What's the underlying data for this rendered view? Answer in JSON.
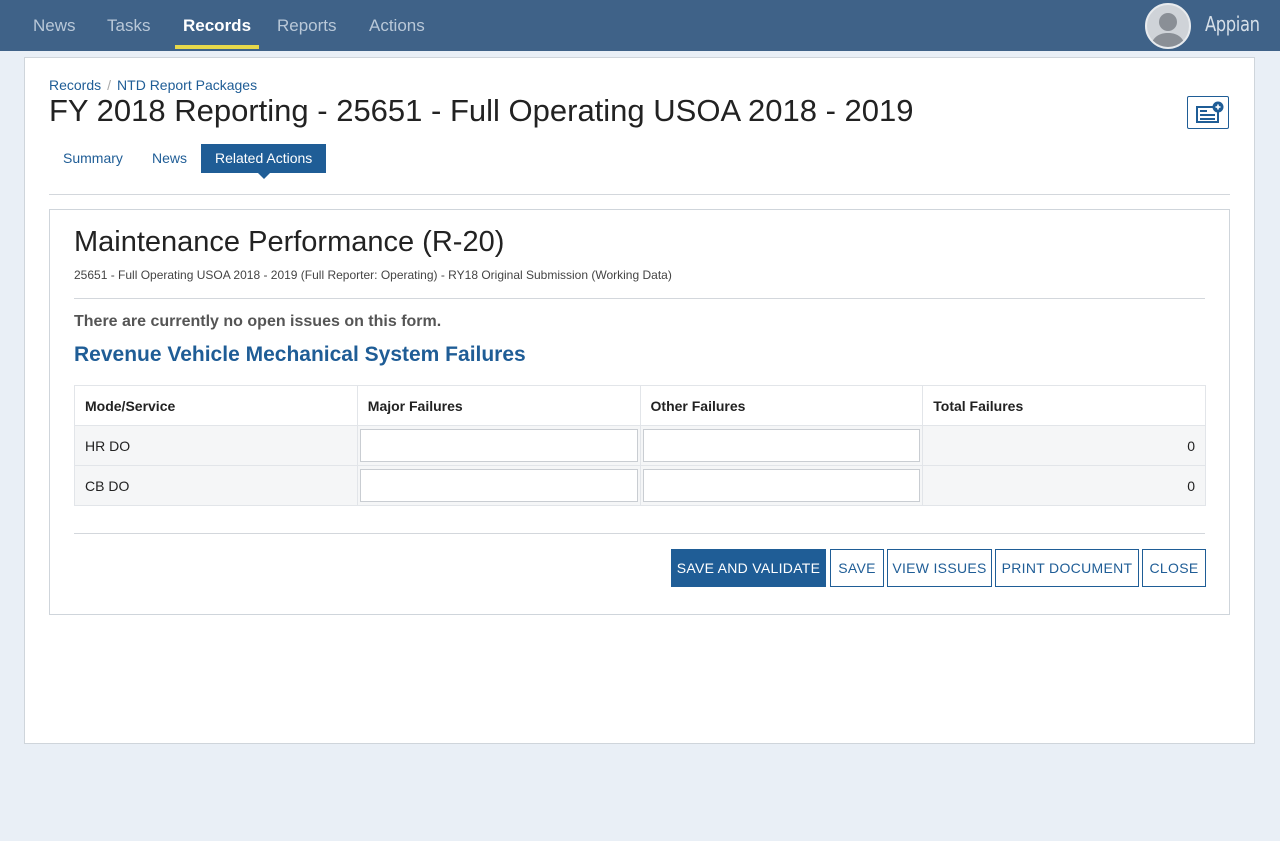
{
  "nav": {
    "items": [
      {
        "label": "News"
      },
      {
        "label": "Tasks"
      },
      {
        "label": "Records"
      },
      {
        "label": "Reports"
      },
      {
        "label": "Actions"
      }
    ],
    "active": "Records",
    "brand": "Appian"
  },
  "breadcrumb": {
    "items": [
      "Records",
      "NTD Report Packages"
    ],
    "separator": "/"
  },
  "page": {
    "title": "FY 2018 Reporting - 25651 - Full Operating USOA 2018 - 2019"
  },
  "tabs": [
    {
      "label": "Summary"
    },
    {
      "label": "News"
    },
    {
      "label": "Related Actions"
    }
  ],
  "active_tab": "Related Actions",
  "form": {
    "title": "Maintenance Performance (R-20)",
    "subtitle": "25651 - Full Operating USOA 2018 - 2019 (Full Reporter: Operating) - RY18 Original Submission (Working Data)",
    "issues_message": "There are currently no open issues on this form.",
    "section_title": "Revenue Vehicle Mechanical System Failures",
    "table": {
      "headers": [
        "Mode/Service",
        "Major Failures",
        "Other Failures",
        "Total Failures"
      ],
      "rows": [
        {
          "mode": "HR DO",
          "major": "",
          "other": "",
          "total": "0"
        },
        {
          "mode": "CB DO",
          "major": "",
          "other": "",
          "total": "0"
        }
      ]
    },
    "buttons": {
      "save_validate": "SAVE AND VALIDATE",
      "save": "SAVE",
      "view_issues": "VIEW ISSUES",
      "print": "PRINT DOCUMENT",
      "close": "CLOSE"
    }
  },
  "colors": {
    "nav_bg": "#3f6288",
    "accent": "#1f5d96",
    "active_underline": "#e6d84a",
    "page_bg": "#e9eff6"
  }
}
